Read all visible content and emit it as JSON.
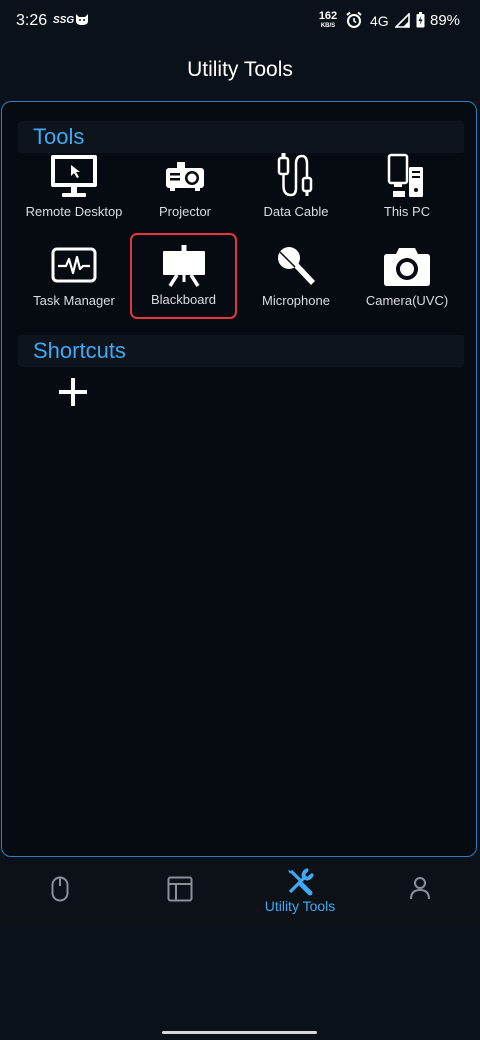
{
  "status_bar": {
    "time": "3:26",
    "carrier_tag": "SSG",
    "data_rate_value": "162",
    "data_rate_unit": "KB/S",
    "network": "4G",
    "battery": "89%",
    "icons": [
      "cat-notification-icon",
      "alarm-icon",
      "signal-icon",
      "battery-icon"
    ]
  },
  "header": {
    "title": "Utility Tools"
  },
  "tools_section": {
    "title": "Tools",
    "items": [
      {
        "label": "Remote Desktop",
        "icon": "monitor-icon"
      },
      {
        "label": "Projector",
        "icon": "projector-icon"
      },
      {
        "label": "Data Cable",
        "icon": "usb-cable-icon"
      },
      {
        "label": "This PC",
        "icon": "pc-tower-icon"
      },
      {
        "label": "Task Manager",
        "icon": "heartbeat-monitor-icon"
      },
      {
        "label": "Blackboard",
        "icon": "easel-board-icon"
      },
      {
        "label": "Microphone",
        "icon": "microphone-icon"
      },
      {
        "label": "Camera(UVC)",
        "icon": "camera-icon"
      }
    ],
    "selected": "Blackboard"
  },
  "shortcuts_section": {
    "title": "Shortcuts",
    "add_icon": "plus-icon"
  },
  "bottom_nav": {
    "items": [
      {
        "label": "",
        "icon": "mouse-icon"
      },
      {
        "label": "",
        "icon": "layout-icon"
      },
      {
        "label": "Utility Tools",
        "icon": "wrench-screwdriver-icon",
        "active": true
      },
      {
        "label": "",
        "icon": "person-icon"
      }
    ]
  },
  "colors": {
    "accent": "#3fa9f5",
    "selected_border": "#e0383e",
    "background": "#0b1118",
    "panel_border": "#2a7fbe"
  }
}
